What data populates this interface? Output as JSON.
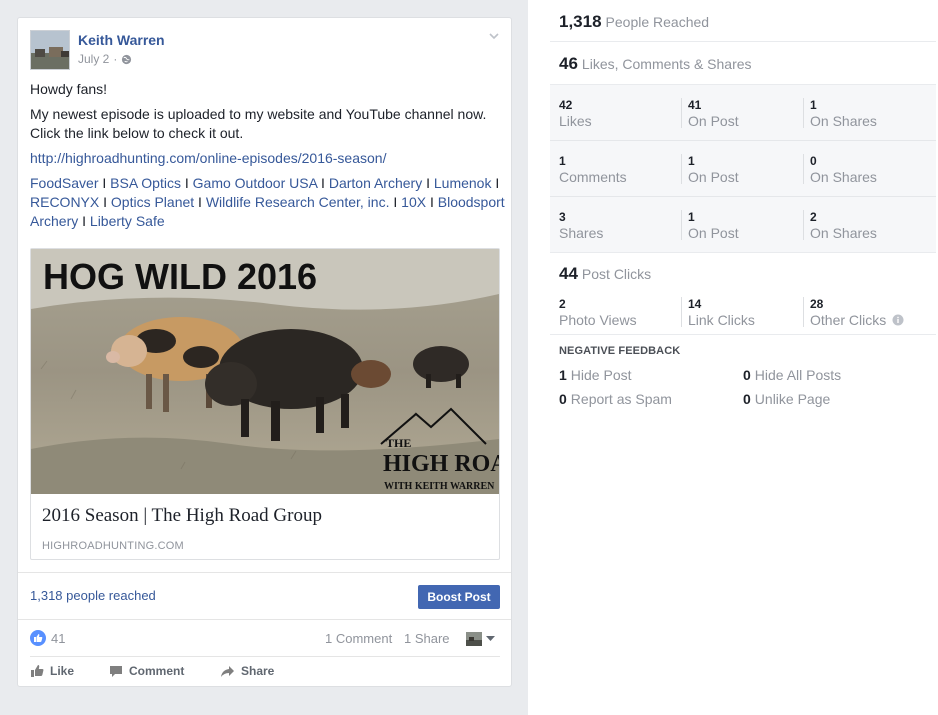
{
  "post": {
    "author": "Keith Warren",
    "date": "July 2",
    "separator": "·",
    "greeting": "Howdy fans!",
    "message": "My newest episode is uploaded to my website and YouTube channel now. Click the link below to check it out.",
    "url": "http://highroadhunting.com/online-episodes/2016-season/",
    "sponsors": [
      "FoodSaver",
      "BSA Optics",
      "Gamo Outdoor USA",
      "Darton Archery",
      "Lumenok",
      "RECONYX",
      "Optics Planet",
      "Wildlife Research Center, inc.",
      "10X",
      "Bloodsport Archery",
      "Liberty Safe"
    ],
    "attachment": {
      "image_headline": "HOG WILD 2016",
      "logo_line1": "THE",
      "logo_line2": "HIGH ROAD",
      "logo_line3": "WITH KEITH WARREN",
      "title": "2016 Season | The High Road Group",
      "domain": "HIGHROADHUNTING.COM"
    },
    "reached_text": "1,318 people reached",
    "boost_label": "Boost Post",
    "like_count": "41",
    "comment_count": "1 Comment",
    "share_count": "1 Share",
    "actions": {
      "like": "Like",
      "comment": "Comment",
      "share": "Share"
    }
  },
  "insights": {
    "reach": {
      "value": "1,318",
      "label": "People Reached"
    },
    "engagement": {
      "value": "46",
      "label": "Likes, Comments & Shares"
    },
    "rows": [
      {
        "total": {
          "n": "42",
          "l": "Likes"
        },
        "on_post": {
          "n": "41",
          "l": "On Post"
        },
        "on_shares": {
          "n": "1",
          "l": "On Shares"
        }
      },
      {
        "total": {
          "n": "1",
          "l": "Comments"
        },
        "on_post": {
          "n": "1",
          "l": "On Post"
        },
        "on_shares": {
          "n": "0",
          "l": "On Shares"
        }
      },
      {
        "total": {
          "n": "3",
          "l": "Shares"
        },
        "on_post": {
          "n": "1",
          "l": "On Post"
        },
        "on_shares": {
          "n": "2",
          "l": "On Shares"
        }
      }
    ],
    "post_clicks": {
      "value": "44",
      "label": "Post Clicks"
    },
    "clicks": [
      {
        "n": "2",
        "l": "Photo Views"
      },
      {
        "n": "14",
        "l": "Link Clicks"
      },
      {
        "n": "28",
        "l": "Other Clicks"
      }
    ],
    "negative": {
      "title": "NEGATIVE FEEDBACK",
      "hide_post": {
        "n": "1",
        "l": "Hide Post"
      },
      "hide_all": {
        "n": "0",
        "l": "Hide All Posts"
      },
      "spam": {
        "n": "0",
        "l": "Report as Spam"
      },
      "unlike": {
        "n": "0",
        "l": "Unlike Page"
      }
    }
  },
  "colors": {
    "link": "#365899",
    "boost": "#4267b2",
    "muted": "#90949c"
  },
  "icons": [
    "chevron-down-icon",
    "globe-icon",
    "like-badge-icon",
    "like-icon",
    "comment-icon",
    "share-icon",
    "info-icon",
    "caret-down-icon"
  ]
}
